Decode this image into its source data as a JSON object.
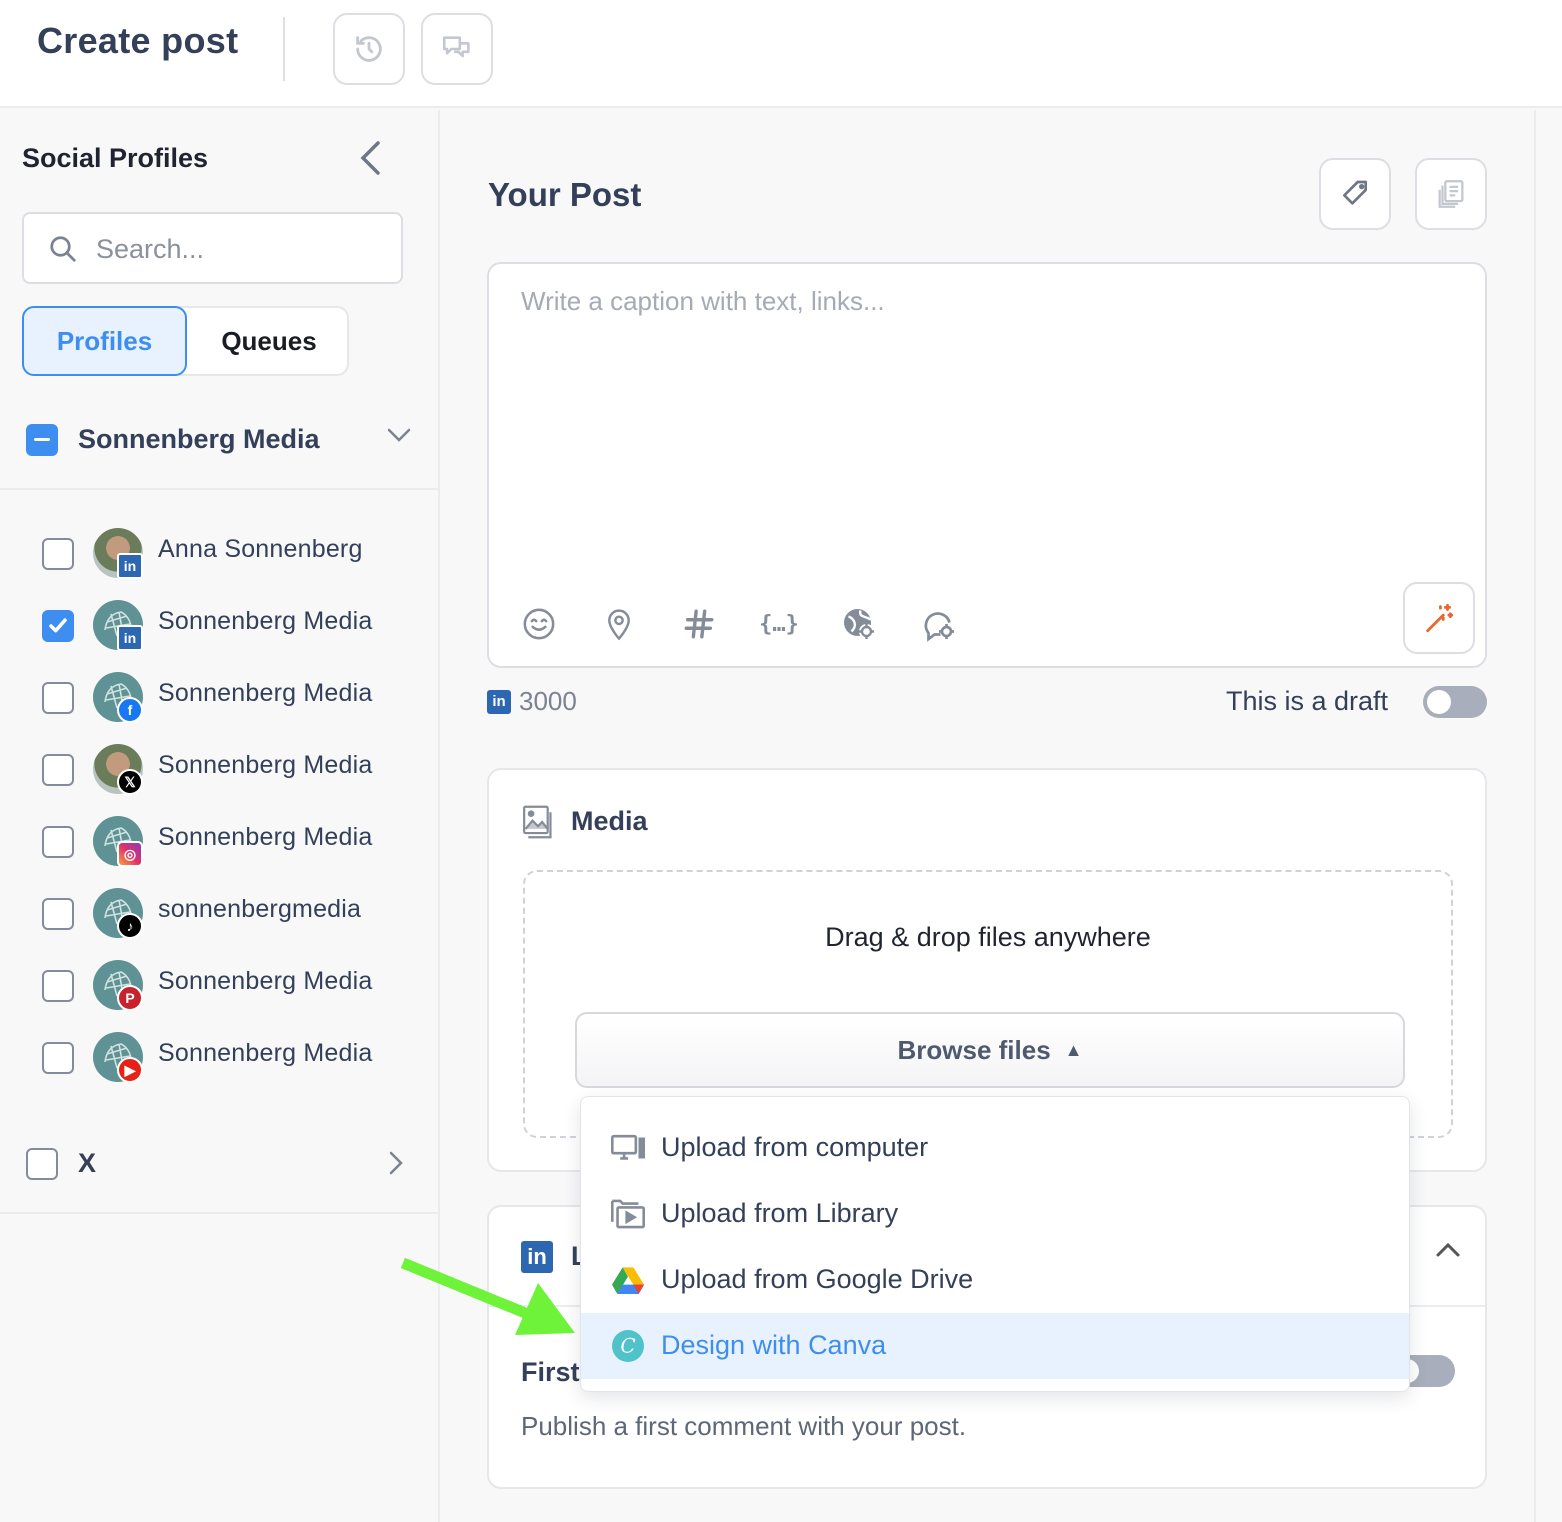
{
  "header": {
    "title": "Create post",
    "icons": [
      "history-icon",
      "comments-icon"
    ]
  },
  "sidebar": {
    "title": "Social Profiles",
    "search": {
      "placeholder": "Search...",
      "value": ""
    },
    "tabs": [
      {
        "label": "Profiles",
        "active": true
      },
      {
        "label": "Queues",
        "active": false
      }
    ],
    "group": {
      "name": "Sonnenberg Media",
      "state": "partial"
    },
    "profiles": [
      {
        "name": "Anna Sonnenberg",
        "network": "linkedin",
        "checked": false,
        "avatar": "person"
      },
      {
        "name": "Sonnenberg Media",
        "network": "linkedin",
        "checked": true,
        "avatar": "logo"
      },
      {
        "name": "Sonnenberg Media",
        "network": "facebook",
        "checked": false,
        "avatar": "logo"
      },
      {
        "name": "Sonnenberg Media",
        "network": "x",
        "checked": false,
        "avatar": "person"
      },
      {
        "name": "Sonnenberg Media",
        "network": "instagram",
        "checked": false,
        "avatar": "logo"
      },
      {
        "name": "sonnenbergmedia",
        "network": "tiktok",
        "checked": false,
        "avatar": "logo"
      },
      {
        "name": "Sonnenberg Media",
        "network": "pinterest",
        "checked": false,
        "avatar": "logo"
      },
      {
        "name": "Sonnenberg Media",
        "network": "youtube",
        "checked": false,
        "avatar": "logo"
      }
    ],
    "x_group": {
      "name": "X",
      "checked": false
    }
  },
  "post": {
    "title": "Your Post",
    "caption": {
      "placeholder": "Write a caption with text, links...",
      "value": ""
    },
    "toolbar": [
      "emoji-icon",
      "location-icon",
      "hashtag-icon",
      "variables-icon",
      "globe-icon",
      "chat-settings-icon"
    ],
    "char_count": "3000",
    "char_network": "in",
    "draft_label": "This is a draft",
    "draft_on": false
  },
  "media": {
    "title": "Media",
    "drop_text": "Drag & drop files anywhere",
    "browse_label": "Browse files",
    "browse_caret": "▲",
    "menu": [
      {
        "label": "Upload from computer",
        "icon": "computer-icon",
        "highlighted": false
      },
      {
        "label": "Upload from Library",
        "icon": "library-icon",
        "highlighted": false
      },
      {
        "label": "Upload from Google Drive",
        "icon": "google-drive-icon",
        "highlighted": false
      },
      {
        "label": "Design with Canva",
        "icon": "canva-icon",
        "highlighted": true
      }
    ]
  },
  "linkedin_section": {
    "title_visible": "L",
    "first_comment_title": "First",
    "first_comment_desc": "Publish a first comment with your post.",
    "first_comment_on": false
  },
  "colors": {
    "accent": "#3d8ef0",
    "linkedin": "#2d67b2",
    "annotation_arrow": "#6ef23a",
    "canva": "#4fc3c9",
    "magic": "#e8692d"
  }
}
